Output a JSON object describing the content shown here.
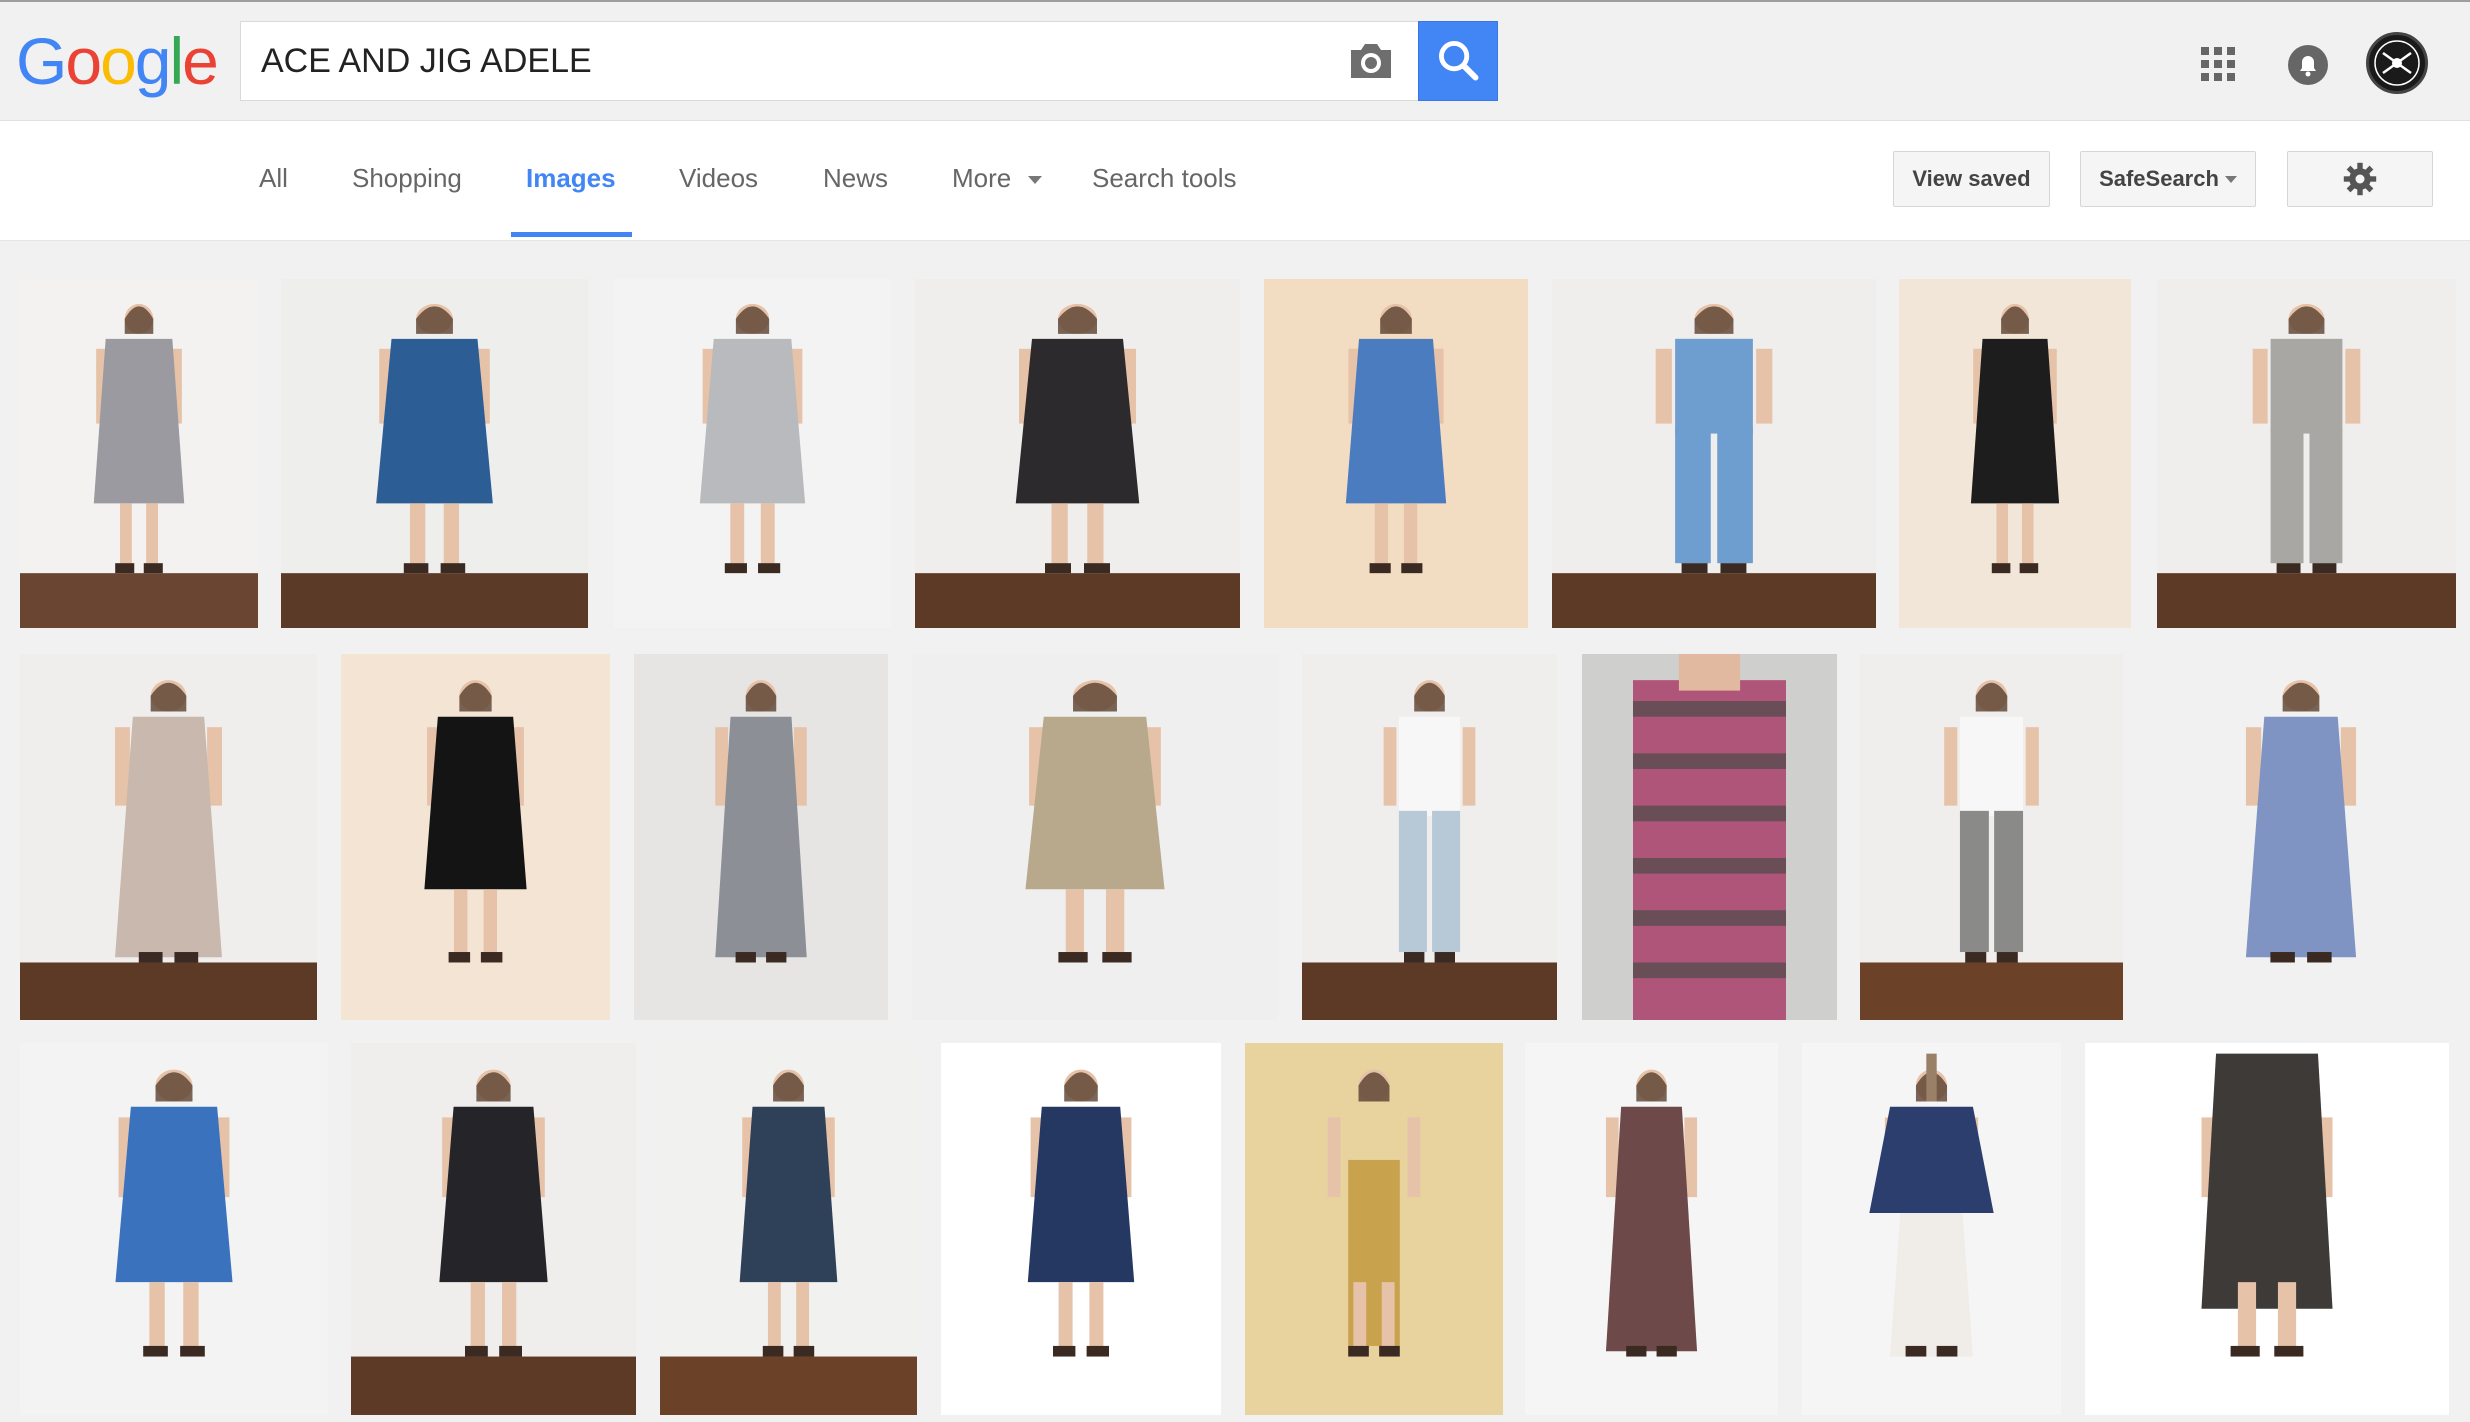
{
  "logo": {
    "letters": [
      "G",
      "o",
      "o",
      "g",
      "l",
      "e"
    ],
    "colors": [
      "#4285f4",
      "#ea4335",
      "#fbbc05",
      "#4285f4",
      "#34a853",
      "#ea4335"
    ]
  },
  "search": {
    "query": "ACE AND JIG ADELE",
    "camera_icon": "camera-icon",
    "search_icon": "search-icon"
  },
  "header_icons": {
    "apps": "apps-grid-icon",
    "notifications": "bell-icon",
    "account": "avatar"
  },
  "colors": {
    "accent": "#4285f4",
    "active_tab": "#4285f4"
  },
  "tabs": [
    {
      "label": "All",
      "active": false
    },
    {
      "label": "Shopping",
      "active": false
    },
    {
      "label": "Images",
      "active": true
    },
    {
      "label": "Videos",
      "active": false
    },
    {
      "label": "News",
      "active": false
    },
    {
      "label": "More",
      "active": false
    },
    {
      "label": "Search tools",
      "active": false
    }
  ],
  "toolbar": {
    "view_saved": "View saved",
    "safesearch": "SafeSearch",
    "settings_icon": "gear-icon"
  },
  "results": [
    {
      "bg": "#f4f2f0",
      "floor": "#6a4632",
      "garment": "#9a9aa0",
      "kind": "dress"
    },
    {
      "bg": "#eeeeed",
      "floor": "#5b3b28",
      "garment": "#2d5d95",
      "kind": "dress"
    },
    {
      "bg": "#f3f3f3",
      "floor": "#f3f3f3",
      "garment": "#b8babd",
      "kind": "dress"
    },
    {
      "bg": "#efeeec",
      "floor": "#5d3a26",
      "garment": "#2c2a2c",
      "kind": "dress"
    },
    {
      "bg": "#f2dcc2",
      "floor": "#f2dcc2",
      "garment": "#4b7cc0",
      "kind": "dress"
    },
    {
      "bg": "#efeeec",
      "floor": "#5d3a26",
      "garment": "#6e9dcf",
      "kind": "jumpsuit"
    },
    {
      "bg": "#f1e6d8",
      "floor": "#f1e6d8",
      "garment": "#1d1d1d",
      "kind": "dress"
    },
    {
      "bg": "#f0eeec",
      "floor": "#5d3a26",
      "garment": "#a8a7a3",
      "kind": "jumpsuit"
    },
    {
      "bg": "#efeeec",
      "floor": "#5d3a26",
      "garment": "#c8b8ae",
      "kind": "maxi"
    },
    {
      "bg": "#f3e4d4",
      "floor": "#f3e4d4",
      "garment": "#141414",
      "kind": "dress"
    },
    {
      "bg": "#e6e5e3",
      "floor": "#e6e5e3",
      "garment": "#8c8f96",
      "kind": "maxi"
    },
    {
      "bg": "#efefef",
      "floor": "#efefef",
      "garment": "#b9a98c",
      "kind": "dress"
    },
    {
      "bg": "#efeeec",
      "floor": "#5d3a26",
      "garment": "#b7c9d6",
      "kind": "pants"
    },
    {
      "bg": "#cfcfcd",
      "floor": "#cfcfcd",
      "garment": "#b0557a",
      "kind": "closeup"
    },
    {
      "bg": "#efeeec",
      "floor": "#6b4127",
      "garment": "#8a8a88",
      "kind": "pants"
    },
    {
      "bg": "#f1f1f1",
      "floor": "#f1f1f1",
      "garment": "#7f94c2",
      "kind": "maxi"
    },
    {
      "bg": "#f3f3f3",
      "floor": "#f3f3f3",
      "garment": "#3a72bd",
      "kind": "dress"
    },
    {
      "bg": "#efeeec",
      "floor": "#5d3a26",
      "garment": "#242429",
      "kind": "dress"
    },
    {
      "bg": "#f1f1ef",
      "floor": "#6b4127",
      "garment": "#2f4159",
      "kind": "dress"
    },
    {
      "bg": "#ffffff",
      "floor": "#ffffff",
      "garment": "#253862",
      "kind": "dress"
    },
    {
      "bg": "#e8d39f",
      "floor": "#e8d39f",
      "garment": "#c9a24e",
      "kind": "kid"
    },
    {
      "bg": "#f5f5f5",
      "floor": "#f5f5f5",
      "garment": "#6d4a49",
      "kind": "maxi"
    },
    {
      "bg": "#f5f5f5",
      "floor": "#f5f5f5",
      "garment": "#2c3e6d",
      "kind": "top"
    },
    {
      "bg": "#ffffff",
      "floor": "#ffffff",
      "garment": "#3d3a37",
      "kind": "skirt"
    }
  ]
}
